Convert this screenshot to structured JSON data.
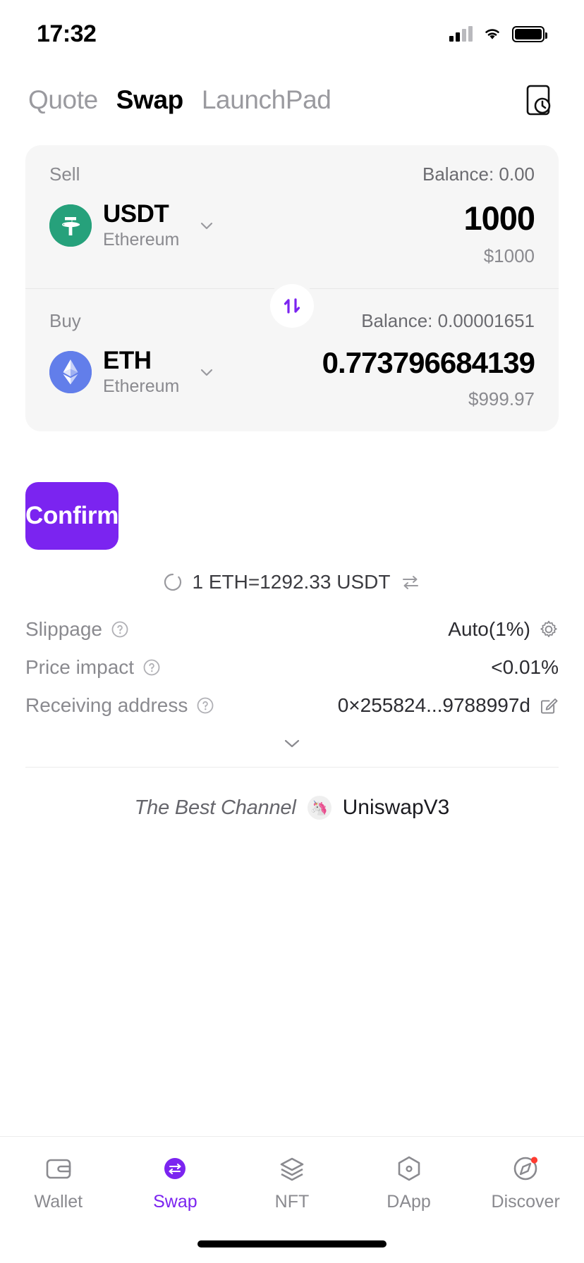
{
  "status_bar": {
    "time": "17:32",
    "signal_icon": "cellular-signal-icon",
    "wifi_icon": "wifi-icon",
    "battery_icon": "battery-full-icon"
  },
  "header": {
    "tabs": [
      {
        "label": "Quote",
        "active": false
      },
      {
        "label": "Swap",
        "active": true
      },
      {
        "label": "LaunchPad",
        "active": false
      }
    ],
    "history_icon": "history-clock-icon"
  },
  "swap_card": {
    "sell": {
      "label": "Sell",
      "balance_label": "Balance: 0.00",
      "token_symbol": "USDT",
      "token_chain": "Ethereum",
      "token_icon": "tether-icon",
      "token_color": "#26a17b",
      "amount": "1000",
      "fiat": "$1000",
      "chevron_icon": "chevron-down-icon"
    },
    "toggle_icon": "swap-vertical-arrows-icon",
    "toggle_color": "#7b24f0",
    "buy": {
      "label": "Buy",
      "balance_label": "Balance: 0.00001651",
      "token_symbol": "ETH",
      "token_chain": "Ethereum",
      "token_icon": "ethereum-icon",
      "token_color": "#627eea",
      "amount": "0.773796684139",
      "fiat": "$999.97",
      "chevron_icon": "chevron-down-icon"
    }
  },
  "confirm_button": {
    "label": "Confirm",
    "color": "#7b24f0"
  },
  "rate": {
    "spinner_icon": "loading-spinner-icon",
    "text": "1 ETH=1292.33 USDT",
    "switch_icon": "swap-horizontal-arrows-icon"
  },
  "details": [
    {
      "label": "Slippage",
      "help_icon": "question-mark-circle-icon",
      "value": "Auto(1%)",
      "trailing_icon": "gear-icon"
    },
    {
      "label": "Price impact",
      "help_icon": "question-mark-circle-icon",
      "value": "<0.01%",
      "trailing_icon": ""
    },
    {
      "label": "Receiving address",
      "help_icon": "question-mark-circle-icon",
      "value": "0×255824...9788997d",
      "trailing_icon": "edit-pencil-icon"
    }
  ],
  "expand_icon": "chevron-down-icon",
  "channel": {
    "label": "The Best Channel",
    "icon": "unicorn-icon",
    "name": "UniswapV3"
  },
  "bottom_nav": [
    {
      "label": "Wallet",
      "icon": "wallet-icon",
      "active": false,
      "badge": false
    },
    {
      "label": "Swap",
      "icon": "swap-icon",
      "active": true,
      "badge": false
    },
    {
      "label": "NFT",
      "icon": "nft-layers-icon",
      "active": false,
      "badge": false
    },
    {
      "label": "DApp",
      "icon": "dapp-cube-icon",
      "active": false,
      "badge": false
    },
    {
      "label": "Discover",
      "icon": "compass-icon",
      "active": false,
      "badge": true
    }
  ]
}
